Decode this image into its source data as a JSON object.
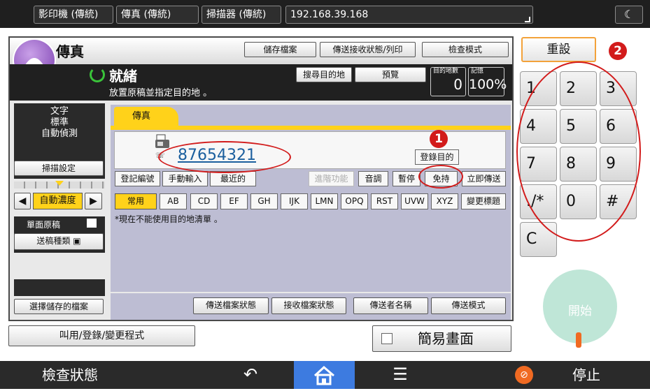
{
  "topbar": {
    "tabs": [
      "影印機 (傳統)",
      "傳真 (傳統)",
      "掃描器 (傳統)"
    ],
    "address": "192.168.39.168",
    "moon_icon": "crescent-moon-icon"
  },
  "app": {
    "title": "傳真",
    "top_buttons": [
      "儲存檔案",
      "傳送接收狀態/列印",
      "檢查模式"
    ],
    "status": "就緒",
    "status_sub": "放置原稿並指定目的地 。",
    "search_dest": "搜尋目的地",
    "preview": "預覽",
    "dest_count_label": "目的地數",
    "dest_count": "0",
    "memory_label": "記憶",
    "memory": "100%"
  },
  "left_panel": {
    "mode_lines": [
      "文字",
      "標準",
      "自動偵測"
    ],
    "scan_settings": "掃描設定",
    "auto_density": "自動濃度",
    "single_sided": "單面原稿",
    "send_type": "送稿種類",
    "select_stored": "選擇儲存的檔案"
  },
  "fax_panel": {
    "tab": "傳真",
    "number": "87654321",
    "register_dest": "登錄目的",
    "row1": [
      "登記編號",
      "手動輸入",
      "最近的",
      "進階功能",
      "音調",
      "暫停",
      "免持",
      "立即傳送"
    ],
    "letters": [
      "常用",
      "AB",
      "CD",
      "EF",
      "GH",
      "IJK",
      "LMN",
      "OPQ",
      "RST",
      "UVW",
      "XYZ",
      "變更標題"
    ],
    "note": "*現在不能使用目的地清單 。",
    "bottom": [
      "傳送檔案狀態",
      "接收檔案狀態",
      "傳送者名稱",
      "傳送模式"
    ]
  },
  "below_screen": {
    "call_register": "叫用/登錄/變更程式",
    "simple_screen": "簡易畫面"
  },
  "keypad": {
    "reset": "重設",
    "keys": [
      "1",
      "2",
      "3",
      "4",
      "5",
      "6",
      "7",
      "8",
      "9",
      "./*",
      "0",
      "#",
      "C"
    ],
    "start": "開始"
  },
  "annotations": {
    "badge1": "1",
    "badge2": "2"
  },
  "bottombar": {
    "check_status": "檢查狀態",
    "stop": "停止"
  },
  "colors": {
    "accent_orange": "#f3a23a",
    "highlight_yellow": "#ffd21a",
    "start_green": "#bfe6d7",
    "annotation_red": "#d21b1b",
    "home_blue": "#3d7be0"
  }
}
